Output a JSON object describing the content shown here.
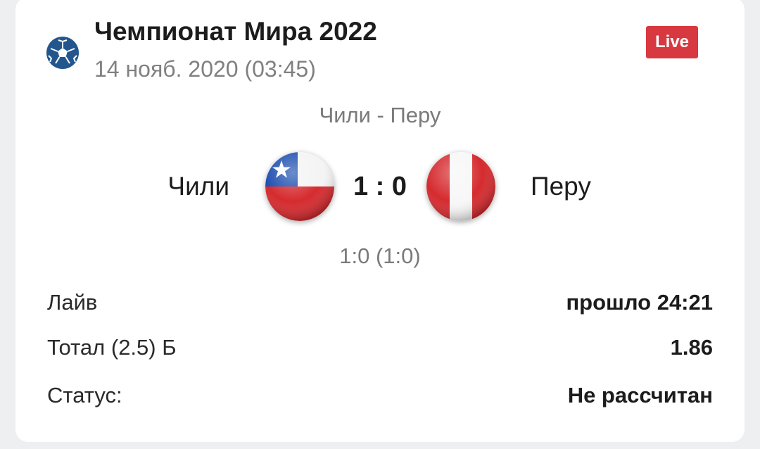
{
  "event": {
    "league_title": "Чемпионат Мира 2022",
    "date": "14 нояб. 2020 (03:45)",
    "live_badge": "Live",
    "league_icon": "soccer-ball-icon"
  },
  "match": {
    "name": "Чили - Перу",
    "home_team": "Чили",
    "away_team": "Перу",
    "home_flag": "chile-flag-icon",
    "away_flag": "peru-flag-icon",
    "score": "1 : 0",
    "period_score": "1:0 (1:0)"
  },
  "details": [
    {
      "label": "Лайв",
      "value": "прошло 24:21"
    },
    {
      "label": "Тотал (2.5) Б",
      "value": "1.86"
    },
    {
      "label": "Статус:",
      "value": "Не рассчитан"
    }
  ],
  "colors": {
    "live_badge": "#d8383f",
    "league_icon": "#23568c",
    "muted_text": "#7a7a7a"
  }
}
